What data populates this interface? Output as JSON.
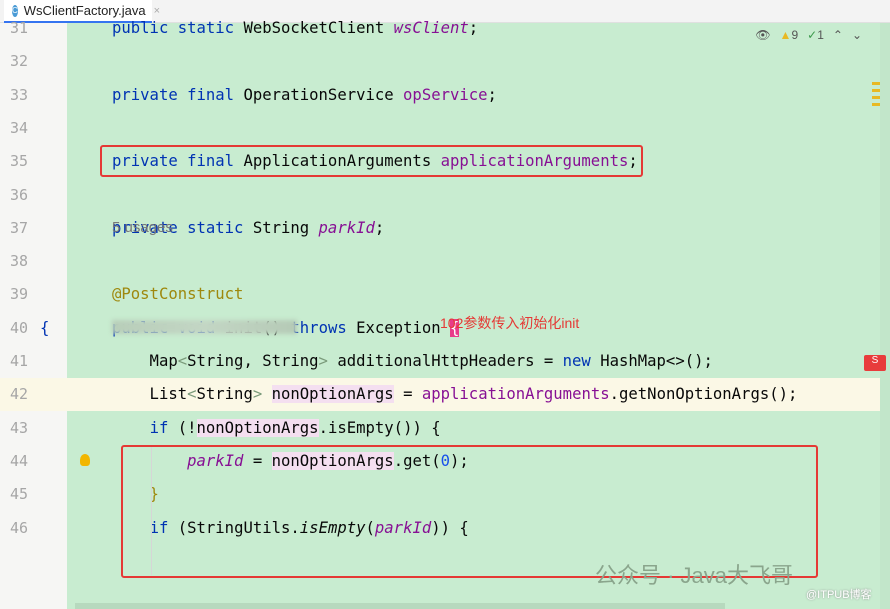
{
  "tab": {
    "icon": "C",
    "title": "WsClientFactory.java",
    "close": "×"
  },
  "status": {
    "warnings": "9",
    "checks": "1"
  },
  "annotation_note": "102参数传入初始化init",
  "usages": "5 usages",
  "watermark": "公众号 · Java大飞哥",
  "watermark2": "@ITPUB博客",
  "logo": "S",
  "lines": [
    {
      "n": "31",
      "t": [
        [
          "public static ",
          "kw"
        ],
        [
          "WebSocketClient ",
          "ty"
        ],
        [
          "wsClient",
          "fld it"
        ],
        [
          ";",
          "ty"
        ]
      ]
    },
    {
      "n": "32",
      "t": []
    },
    {
      "n": "33",
      "t": [
        [
          "private final ",
          "kw"
        ],
        [
          "OperationService ",
          "ty"
        ],
        [
          "opService",
          "fld"
        ],
        [
          ";",
          "ty"
        ]
      ]
    },
    {
      "n": "34",
      "t": []
    },
    {
      "n": "35",
      "t": [
        [
          "private final ",
          "kw"
        ],
        [
          "ApplicationArguments ",
          "ty"
        ],
        [
          "applicationArguments",
          "fld"
        ],
        [
          ";",
          "ty"
        ]
      ]
    },
    {
      "n": "36",
      "t": []
    },
    {
      "n": "37",
      "t": [
        [
          "private static ",
          "kw"
        ],
        [
          "String ",
          "ty"
        ],
        [
          "parkId",
          "fld it"
        ],
        [
          ";",
          "ty"
        ]
      ]
    },
    {
      "n": "38",
      "t": []
    },
    {
      "n": "39",
      "t": [
        [
          "@PostConstruct",
          "ann"
        ]
      ]
    },
    {
      "n": "40",
      "t": [
        [
          "public void ",
          "kw"
        ],
        [
          "init",
          "dim"
        ],
        [
          "() ",
          "ty"
        ],
        [
          "throws ",
          "kw"
        ],
        [
          "Exception ",
          "ty"
        ],
        [
          "{",
          "brace"
        ]
      ]
    },
    {
      "n": "41",
      "t": [
        [
          "    Map",
          "ty"
        ],
        [
          "<",
          "gr"
        ],
        [
          "String, String",
          "ty"
        ],
        [
          "> ",
          "gr"
        ],
        [
          "additionalHttpHeaders = ",
          "ty"
        ],
        [
          "new ",
          "kw"
        ],
        [
          "HashMap<>();",
          "ty"
        ]
      ]
    },
    {
      "n": "42",
      "t": [
        [
          "    List",
          "ty"
        ],
        [
          "<",
          "gr"
        ],
        [
          "String",
          "ty"
        ],
        [
          "> ",
          "gr"
        ],
        [
          "nonOptionArgs",
          "ty hl"
        ],
        [
          " = ",
          "ty"
        ],
        [
          "applicationArguments",
          "fld"
        ],
        [
          ".getNonOptionArgs();",
          "ty"
        ]
      ]
    },
    {
      "n": "43",
      "t": [
        [
          "    ",
          "ty"
        ],
        [
          "if ",
          "kw"
        ],
        [
          "(!",
          "ty"
        ],
        [
          "nonOptionArgs",
          "ty hl"
        ],
        [
          ".isEmpty()) {",
          "ty"
        ]
      ]
    },
    {
      "n": "44",
      "t": [
        [
          "        ",
          "ty"
        ],
        [
          "parkId",
          "fld it"
        ],
        [
          " = ",
          "ty"
        ],
        [
          "nonOptionArgs",
          "ty hl"
        ],
        [
          ".get(",
          "ty"
        ],
        [
          "0",
          "num"
        ],
        [
          ");",
          "ty"
        ]
      ]
    },
    {
      "n": "45",
      "t": [
        [
          "    }",
          "ann"
        ]
      ]
    },
    {
      "n": "46",
      "t": [
        [
          "    ",
          "ty"
        ],
        [
          "if ",
          "kw"
        ],
        [
          "(StringUtils.",
          "ty"
        ],
        [
          "isEmpty",
          "ty it"
        ],
        [
          "(",
          "ty"
        ],
        [
          "parkId",
          "fld it"
        ],
        [
          ")) {",
          "ty"
        ]
      ]
    }
  ]
}
